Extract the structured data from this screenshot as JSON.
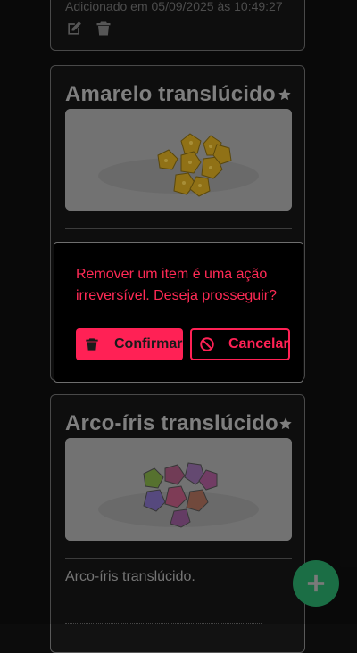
{
  "cards": [
    {
      "meta": "Adicionado em 05/09/2025 às 10:49:27"
    },
    {
      "title": "Amarelo translúcido",
      "photo_alt": "yellow-dice-photo"
    },
    {
      "title": "Arco-íris translúcido",
      "description": "Arco-íris translúcido.",
      "photo_alt": "rainbow-dice-photo"
    }
  ],
  "modal": {
    "message": "Remover um item é uma ação irreversível. Deseja prosseguir?",
    "confirm_label": "Confirmar",
    "cancel_label": "Cancelar"
  },
  "colors": {
    "accent": "#ff2155",
    "fab": "#1b6e45",
    "background": "#0c0c0c"
  },
  "icons": [
    "edit-icon",
    "trash-icon",
    "star-icon",
    "ban-icon",
    "plus-icon"
  ]
}
